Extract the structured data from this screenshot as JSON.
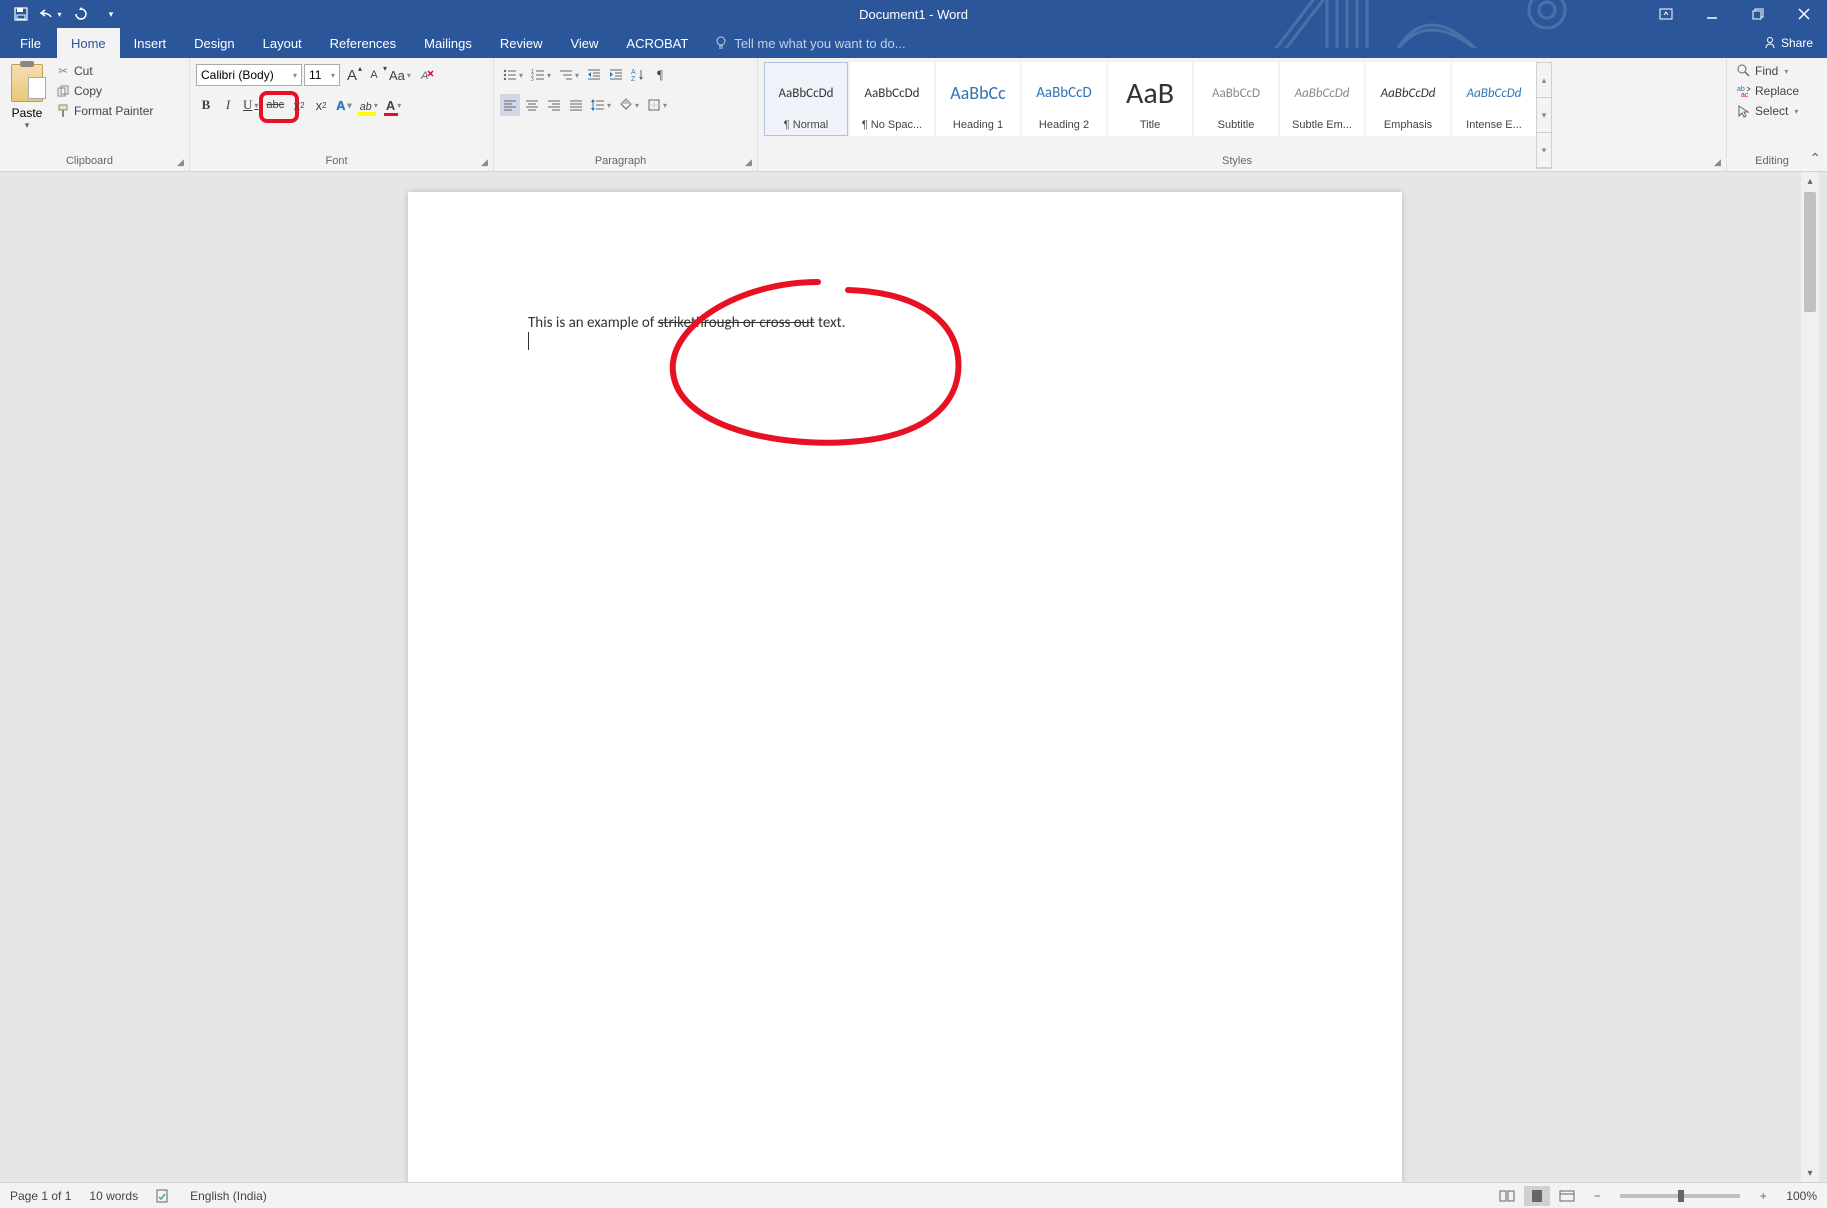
{
  "title": "Document1 - Word",
  "qat": {
    "save": "Save",
    "undo": "Undo",
    "redo": "Repeat"
  },
  "window": {
    "ribbon_opts": "Ribbon Display Options",
    "min": "Minimize",
    "max": "Restore",
    "close": "Close"
  },
  "tabs": {
    "file": "File",
    "home": "Home",
    "insert": "Insert",
    "design": "Design",
    "layout": "Layout",
    "references": "References",
    "mailings": "Mailings",
    "review": "Review",
    "view": "View",
    "acrobat": "ACROBAT"
  },
  "tellme": "Tell me what you want to do...",
  "share": "Share",
  "clipboard": {
    "label": "Clipboard",
    "paste": "Paste",
    "cut": "Cut",
    "copy": "Copy",
    "format_painter": "Format Painter"
  },
  "font": {
    "label": "Font",
    "name": "Calibri (Body)",
    "size": "11",
    "grow": "A",
    "shrink": "A",
    "case": "Aa",
    "clear": "Clear Formatting",
    "bold": "B",
    "italic": "I",
    "underline": "U",
    "strike": "abc",
    "subscript": "x",
    "superscript": "x",
    "effects": "A",
    "highlight": "ab",
    "color": "A"
  },
  "paragraph": {
    "label": "Paragraph"
  },
  "styles": {
    "label": "Styles",
    "items": [
      {
        "preview": "AaBbCcDd",
        "name": "¶ Normal",
        "color": "#333",
        "size": "13px",
        "para": true
      },
      {
        "preview": "AaBbCcDd",
        "name": "¶ No Spac...",
        "color": "#333",
        "size": "13px",
        "para": true
      },
      {
        "preview": "AaBbCc",
        "name": "Heading 1",
        "color": "#2e74b5",
        "size": "18px"
      },
      {
        "preview": "AaBbCcD",
        "name": "Heading 2",
        "color": "#2e74b5",
        "size": "15px"
      },
      {
        "preview": "AaB",
        "name": "Title",
        "color": "#333",
        "size": "30px"
      },
      {
        "preview": "AaBbCcD",
        "name": "Subtitle",
        "color": "#888",
        "size": "13px"
      },
      {
        "preview": "AaBbCcDd",
        "name": "Subtle Em...",
        "color": "#888",
        "size": "13px",
        "italic": true
      },
      {
        "preview": "AaBbCcDd",
        "name": "Emphasis",
        "color": "#333",
        "size": "13px",
        "italic": true
      },
      {
        "preview": "AaBbCcDd",
        "name": "Intense E...",
        "color": "#2e74b5",
        "size": "13px",
        "italic": true
      }
    ]
  },
  "editing": {
    "label": "Editing",
    "find": "Find",
    "replace": "Replace",
    "select": "Select"
  },
  "document": {
    "text_before": "This is an example of ",
    "text_strike": "strikethrough or cross out",
    "text_after": " text."
  },
  "status": {
    "page": "Page 1 of 1",
    "words": "10 words",
    "proof": "No proofing errors",
    "lang": "English (India)",
    "zoom": "100%"
  }
}
